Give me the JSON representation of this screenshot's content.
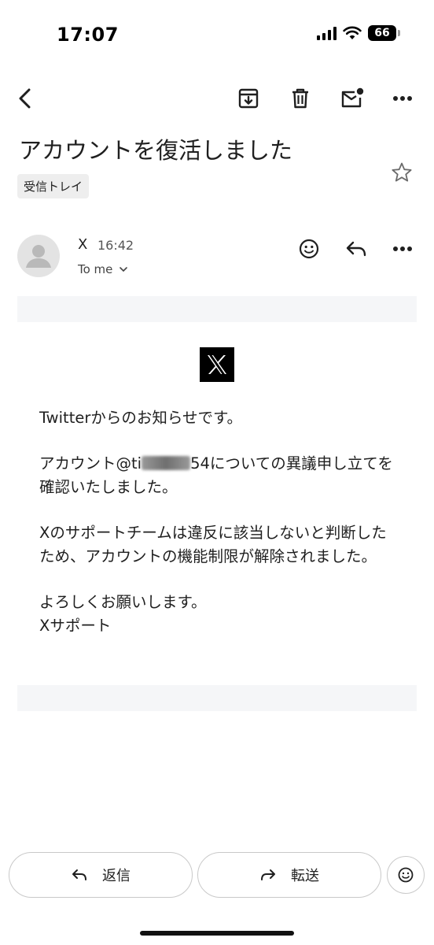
{
  "status_bar": {
    "time": "17:07",
    "battery": "66"
  },
  "email": {
    "subject": "アカウントを復活しました",
    "label": "受信トレイ",
    "sender": {
      "name": "X",
      "time": "16:42",
      "recipient": "To me"
    },
    "body": {
      "intro": "Twitterからのお知らせです。",
      "appeal_before": "アカウント@ti",
      "appeal_after": "54についての異議申し立てを確認いたしました。",
      "result": "Xのサポートチームは違反に該当しないと判断したため、アカウントの機能制限が解除されました。",
      "closing_1": "よろしくお願いします。",
      "closing_2": "Xサポート"
    }
  },
  "actions": {
    "reply": "返信",
    "forward": "転送"
  },
  "icons": [
    "back-icon",
    "archive-icon",
    "delete-icon",
    "mark-unread-icon",
    "more-icon",
    "star-icon",
    "emoji-icon",
    "reply-icon",
    "forward-icon"
  ]
}
